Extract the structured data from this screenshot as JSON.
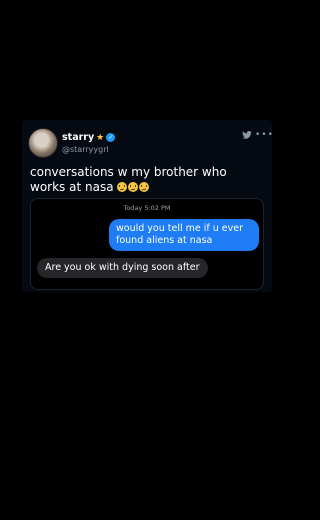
{
  "tweet": {
    "display_name": "starry",
    "handle": "@starryygrl",
    "text": "conversations w my brother who works at nasa",
    "emojis": [
      "confused-face",
      "confused-face",
      "confused-face"
    ]
  },
  "imessage": {
    "timestamp": "Today 5:02 PM",
    "messages": [
      {
        "direction": "outgoing",
        "text": "would you tell me if u ever found aliens at nasa"
      },
      {
        "direction": "incoming",
        "text": "Are you ok with dying soon after"
      }
    ]
  },
  "colors": {
    "background": "#000000",
    "card": "#050a12",
    "outgoing_bubble": "#1e7cf5",
    "incoming_bubble": "#26252a",
    "verified": "#1d9bf0",
    "star": "#ffcc33"
  }
}
